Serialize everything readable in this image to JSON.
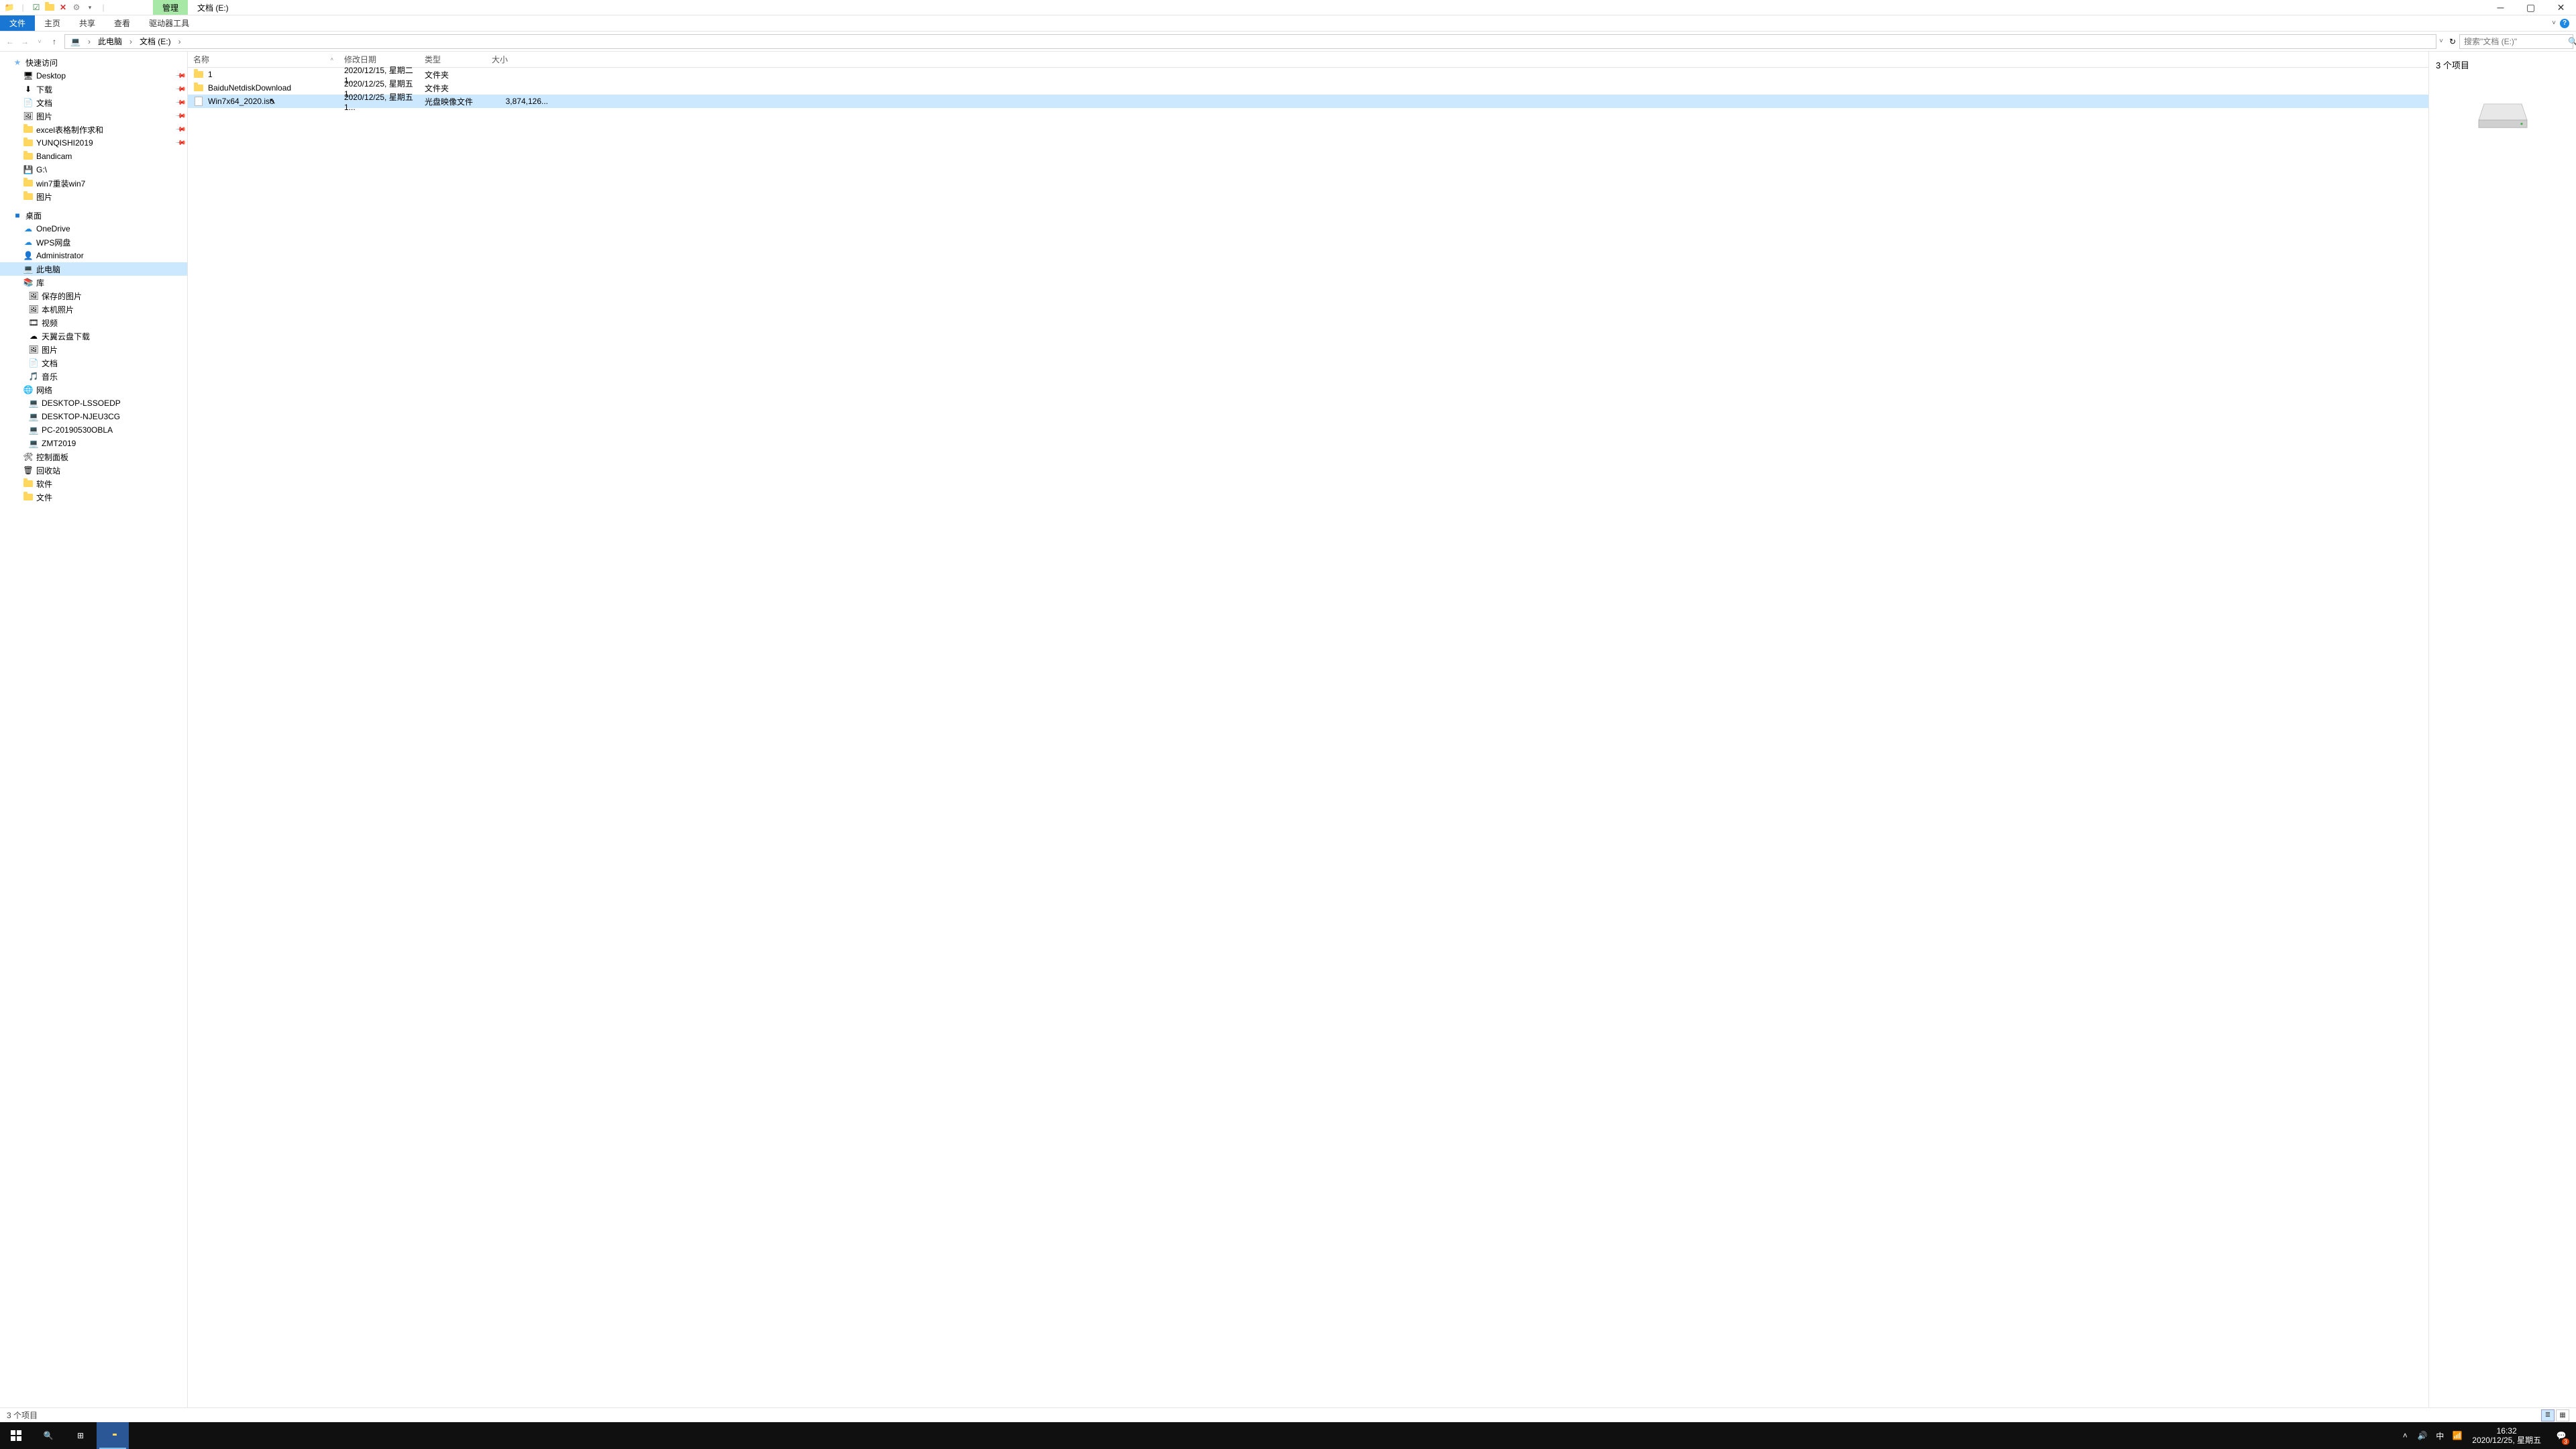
{
  "title": {
    "manage": "管理",
    "location": "文档 (E:)"
  },
  "ribbon": {
    "file": "文件",
    "home": "主页",
    "share": "共享",
    "view": "查看",
    "drive_tools": "驱动器工具"
  },
  "breadcrumb": {
    "this_pc": "此电脑",
    "drive": "文档 (E:)"
  },
  "search": {
    "placeholder": "搜索\"文档 (E:)\""
  },
  "nav": {
    "quick_access": "快速访问",
    "desktop": "Desktop",
    "downloads": "下载",
    "documents": "文档",
    "pictures": "图片",
    "excel": "excel表格制作求和",
    "yunqishi": "YUNQISHI2019",
    "bandicam": "Bandicam",
    "gdrive": "G:\\",
    "win7": "win7重装win7",
    "pictures_zh": "图片",
    "desktop_zh": "桌面",
    "onedrive": "OneDrive",
    "wps": "WPS网盘",
    "administrator": "Administrator",
    "this_pc": "此电脑",
    "library": "库",
    "saved_pics": "保存的图片",
    "local_photos": "本机照片",
    "video": "视频",
    "tianyi": "天翼云盘下载",
    "lib_pictures": "图片",
    "lib_docs": "文档",
    "music": "音乐",
    "network": "网络",
    "net1": "DESKTOP-LSSOEDP",
    "net2": "DESKTOP-NJEU3CG",
    "net3": "PC-20190530OBLA",
    "net4": "ZMT2019",
    "control_panel": "控制面板",
    "recycle_bin": "回收站",
    "software": "软件",
    "files": "文件"
  },
  "columns": {
    "name": "名称",
    "date": "修改日期",
    "type": "类型",
    "size": "大小"
  },
  "files": [
    {
      "name": "1",
      "date": "2020/12/15, 星期二 1...",
      "type": "文件夹",
      "size": "",
      "icon": "folder"
    },
    {
      "name": "BaiduNetdiskDownload",
      "date": "2020/12/25, 星期五 1...",
      "type": "文件夹",
      "size": "",
      "icon": "folder"
    },
    {
      "name": "Win7x64_2020.iso",
      "date": "2020/12/25, 星期五 1...",
      "type": "光盘映像文件",
      "size": "3,874,126...",
      "icon": "file"
    }
  ],
  "preview": {
    "count": "3 个项目"
  },
  "statusbar": {
    "items": "3 个项目"
  },
  "taskbar": {
    "time": "16:32",
    "date": "2020/12/25, 星期五",
    "ime": "中",
    "notif": "3"
  }
}
